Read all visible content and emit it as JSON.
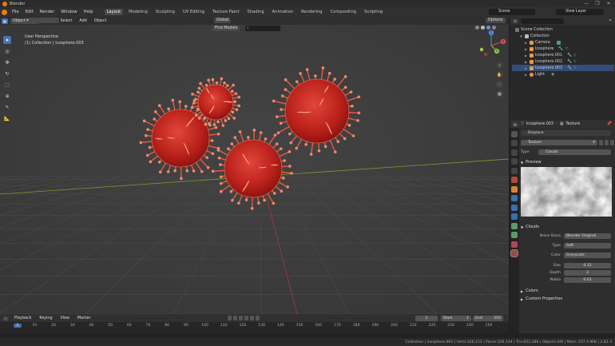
{
  "window": {
    "title": "Blender",
    "min": "—",
    "max": "❐",
    "close": "✕"
  },
  "menus": [
    "File",
    "Edit",
    "Render",
    "Window",
    "Help"
  ],
  "workspaces": [
    "Layout",
    "Modeling",
    "Sculpting",
    "UV Editing",
    "Texture Paint",
    "Shading",
    "Animation",
    "Rendering",
    "Compositing",
    "Scripting"
  ],
  "active_workspace": "Layout",
  "scene": {
    "name": "Scene",
    "view_layer": "View Layer"
  },
  "viewport": {
    "mode": "Object Mode",
    "menus": [
      "View",
      "Select",
      "Add",
      "Object"
    ],
    "orientation": "Global",
    "find": "Find Models",
    "options": "Options",
    "perspective": "User Perspective",
    "collection_info": "(1) Collection | Icosphere.003",
    "gizmo": {
      "x": "X",
      "y": "Y",
      "z": "Z"
    }
  },
  "outliner": {
    "items": [
      {
        "label": "Scene Collection",
        "level": 0
      },
      {
        "label": "Collection",
        "level": 1
      },
      {
        "label": "Camera",
        "level": 2
      },
      {
        "label": "Icosphere",
        "level": 2
      },
      {
        "label": "Icosphere.001",
        "level": 2
      },
      {
        "label": "Icosphere.002",
        "level": 2
      },
      {
        "label": "Icosphere.003",
        "level": 2
      },
      {
        "label": "Light",
        "level": 2
      }
    ]
  },
  "properties": {
    "object": "Icosphere.003",
    "context": "Texture",
    "modifier": "Displace",
    "texture_name": "Texture",
    "texture_users": "4",
    "type_label": "Type",
    "type_value": "Clouds",
    "preview_label": "Preview",
    "clouds_label": "Clouds",
    "noise_basis_label": "Noise Basis",
    "noise_basis_value": "Blender Original",
    "noise_type_label": "Type",
    "noise_type_value": "Soft",
    "color_label": "Color",
    "color_value": "Greyscale",
    "size_label": "Size",
    "size_value": "0.31",
    "depth_label": "Depth",
    "depth_value": "3",
    "nabla_label": "Nabla",
    "nabla_value": "0.03",
    "colors_label": "Colors",
    "custom_label": "Custom Properties"
  },
  "timeline": {
    "menus": [
      "Playback",
      "Keying",
      "View",
      "Marker"
    ],
    "current_frame": "1",
    "start_label": "Start",
    "start_value": "1",
    "end_label": "End",
    "end_value": "250",
    "ticks": [
      "1",
      "10",
      "20",
      "30",
      "40",
      "50",
      "60",
      "70",
      "80",
      "90",
      "100",
      "110",
      "120",
      "130",
      "140",
      "150",
      "160",
      "170",
      "180",
      "190",
      "200",
      "210",
      "220",
      "230",
      "240",
      "250"
    ]
  },
  "status": "Collection | Icosphere.003 | Verts:326,152 | Faces:326,144 | Tris:652,288 | Objects:0/6 | Mem: 257.4 MiB | 2.83.3",
  "colors": {
    "virus": "#c8261c",
    "accent": "#4772b3",
    "blender_orange": "#e87d0d"
  }
}
